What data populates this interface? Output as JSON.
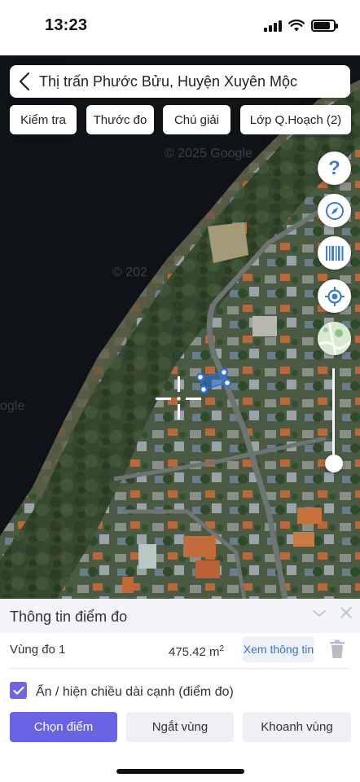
{
  "status_bar": {
    "time": "13:23",
    "battery_level_percent": 85
  },
  "map": {
    "watermarks": [
      "© 2025 Google",
      "© 202",
      "ogle"
    ],
    "marker_color": "#2f6fe0"
  },
  "search": {
    "title": "Thị trấn Phước Bửu, Huyện Xuyên Mộc"
  },
  "toolbar": {
    "check": "Kiểm tra",
    "measure": "Thước đo",
    "legend": "Chú giải",
    "layers": "Lớp Q.Hoạch (2)"
  },
  "side_controls": [
    "help-icon",
    "compass-icon",
    "barcode-icon",
    "locate-icon",
    "map-layer-icon"
  ],
  "panel": {
    "title": "Thông tin điểm đo",
    "area_label": "Vùng đo 1",
    "area_value": "475.42 m",
    "area_unit_power": "2",
    "info_button": "Xem thông tin",
    "toggle_label": "Ẩn / hiện chiều dài cạnh (điểm đo)",
    "toggle_checked": true,
    "actions": {
      "select_point": "Chọn điểm",
      "break_area": "Ngắt vùng",
      "close_area": "Khoanh vùng"
    }
  },
  "colors": {
    "primary": "#6b63e6",
    "link": "#3b6fd8",
    "marker": "#2f6fe0"
  }
}
